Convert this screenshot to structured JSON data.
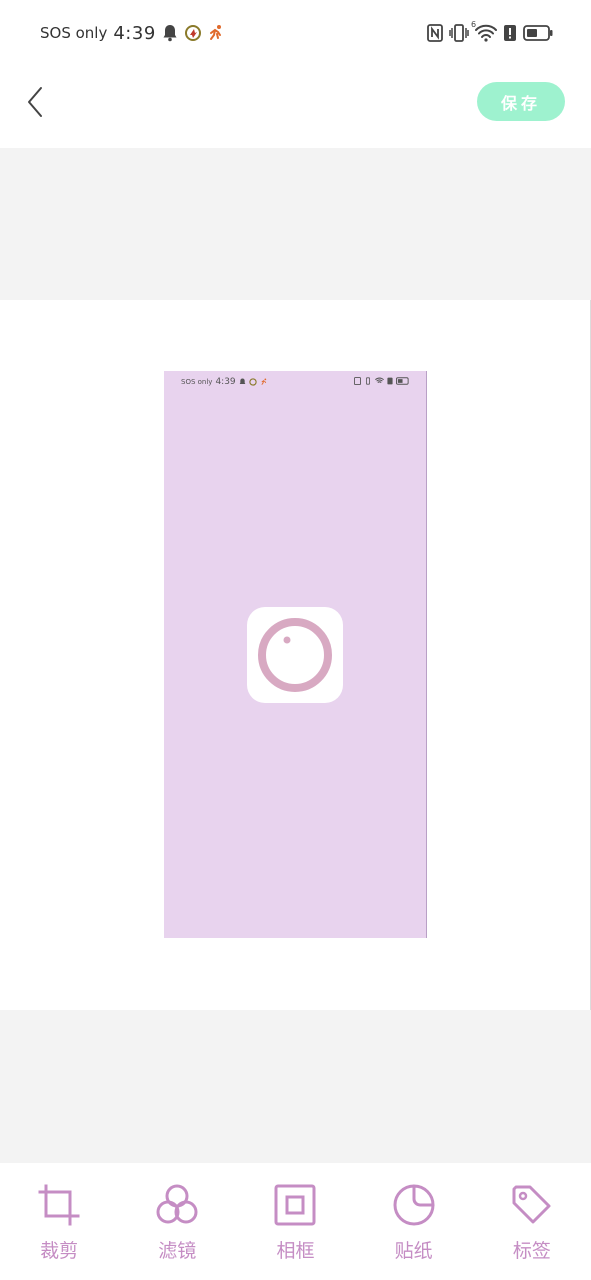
{
  "status_bar": {
    "sos_text": "SOS only",
    "time": "4:39",
    "signal_label": "6",
    "icons": [
      "bell-icon",
      "app-notification-icon",
      "runner-icon",
      "nfc-icon",
      "vibrate-icon",
      "wifi-icon",
      "alert-icon",
      "battery-icon"
    ]
  },
  "topbar": {
    "back_icon": "chevron-left-icon",
    "save_label": "保存"
  },
  "preview": {
    "status_sos_text": "SOS only",
    "status_time": "4:39",
    "background_color": "#e8d3ee",
    "app_icon": "camera-ring-icon"
  },
  "toolbar": {
    "items": [
      {
        "label": "裁剪",
        "icon": "crop-icon"
      },
      {
        "label": "滤镜",
        "icon": "filter-icon"
      },
      {
        "label": "相框",
        "icon": "frame-icon"
      },
      {
        "label": "贴纸",
        "icon": "sticker-icon"
      },
      {
        "label": "标签",
        "icon": "tag-icon"
      }
    ]
  },
  "colors": {
    "accent": "#9ef2cf",
    "tool_color": "#c58dc4",
    "canvas_gray": "#f3f3f3",
    "preview_ring": "#d8a9c2"
  }
}
